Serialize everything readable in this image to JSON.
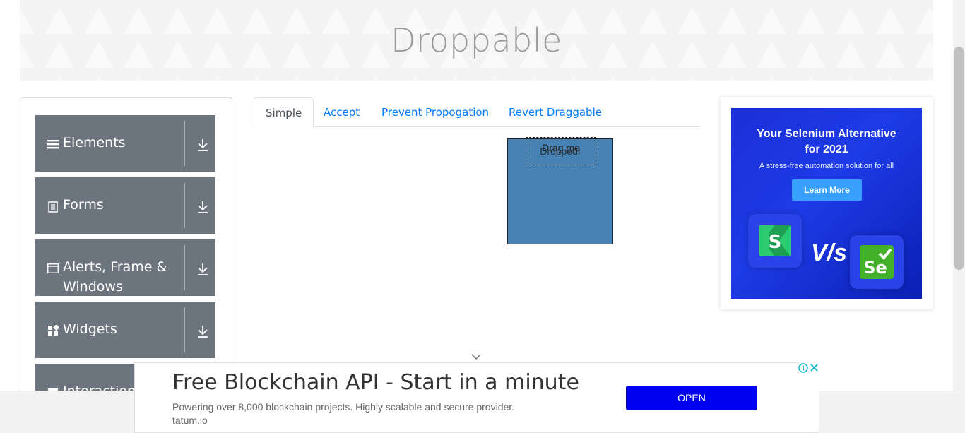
{
  "page": {
    "title": "Droppable"
  },
  "sidebar": {
    "groups": [
      {
        "label": "Elements",
        "icon": "hamburger-icon"
      },
      {
        "label": "Forms",
        "icon": "document-icon"
      },
      {
        "label": "Alerts, Frame & Windows",
        "icon": "window-icon"
      },
      {
        "label": "Widgets",
        "icon": "widgets-icon"
      },
      {
        "label": "Interactions",
        "icon": "interactions-icon"
      }
    ]
  },
  "tabs": [
    {
      "label": "Simple",
      "active": true
    },
    {
      "label": "Accept",
      "active": false
    },
    {
      "label": "Prevent Propogation",
      "active": false
    },
    {
      "label": "Revert Draggable",
      "active": false
    }
  ],
  "simple": {
    "drag_label": "Drag me",
    "drop_label": "Dropped!",
    "drop_color": "#4682b4"
  },
  "ad_side": {
    "headline_1": "Your Selenium Alternative",
    "headline_2": "for 2021",
    "subtitle": "A stress-free automation solution for all",
    "button": "Learn More",
    "vs_text": "V/s"
  },
  "ad_bottom": {
    "headline": "Free Blockchain API - Start in a minute",
    "description": "Powering over 8,000 blockchain projects. Highly scalable and secure provider.",
    "url": "tatum.io",
    "button": "OPEN"
  },
  "colors": {
    "accent": "#007bff",
    "sidebar_group": "#6c757d",
    "ad_button": "#0000f0"
  }
}
